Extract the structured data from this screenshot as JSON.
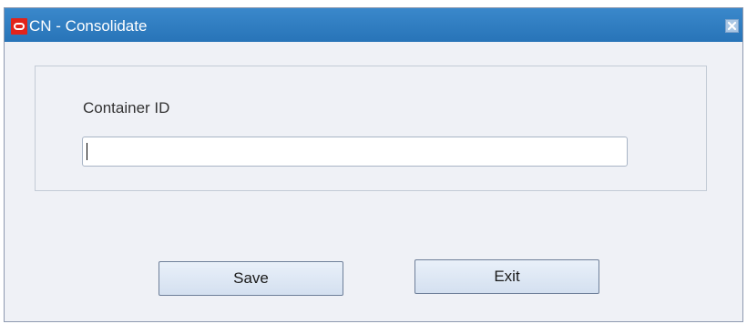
{
  "window": {
    "title": "CN - Consolidate"
  },
  "icons": {
    "app": "oracle-logo-icon",
    "close": "close-icon"
  },
  "colors": {
    "titlebar": "#2f7ec2",
    "logo": "#e2231a",
    "background": "#eff1f6"
  },
  "form": {
    "container_id_label": "Container ID",
    "container_id_value": ""
  },
  "buttons": {
    "save_label": "Save",
    "exit_label": "Exit"
  }
}
